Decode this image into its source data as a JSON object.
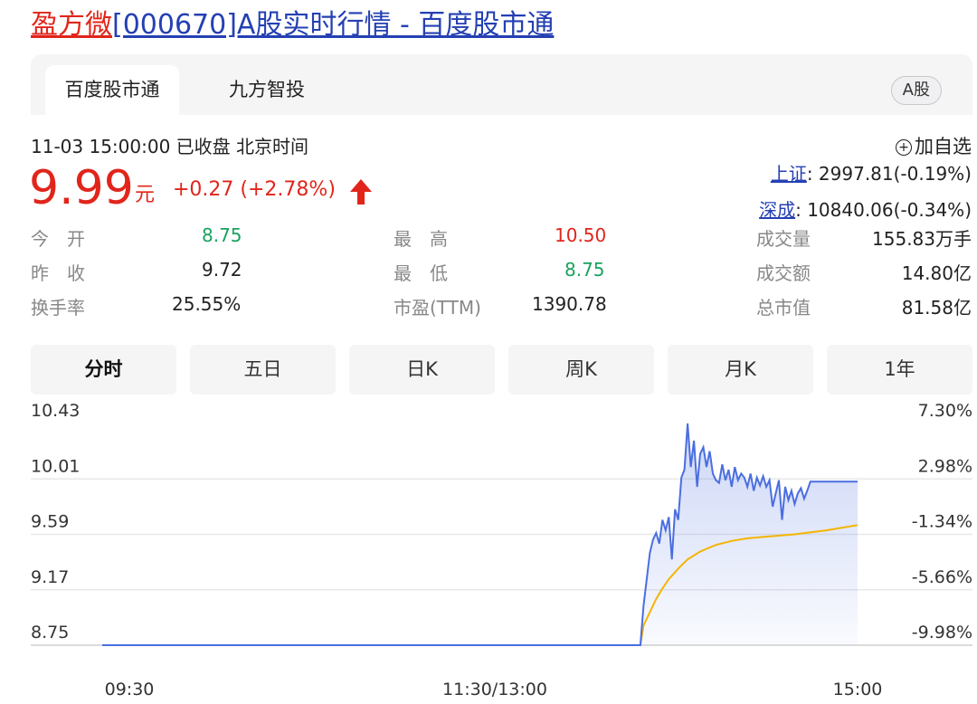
{
  "page_title": {
    "stock_name": "盈方微",
    "rest": "[000670]A股实时行情 - 百度股市通"
  },
  "tabs": {
    "active": "百度股市通",
    "second": "九方智投",
    "badge": "A股"
  },
  "status": {
    "datetime": "11-03 15:00:00",
    "state": "已收盘",
    "timezone": "北京时间",
    "add_favorite": "加自选"
  },
  "quote": {
    "price": "9.99",
    "unit": "元",
    "change": "+0.27 (+2.78%)"
  },
  "indices": [
    {
      "name": "上证",
      "value": ": 2997.81(-0.19%)"
    },
    {
      "name": "深成",
      "value": ": 10840.06(-0.34%)"
    }
  ],
  "stats": {
    "open_label": "今　开",
    "open_value": "8.75",
    "prev_close_label": "昨　收",
    "prev_close_value": "9.72",
    "turnover_label": "换手率",
    "turnover_value": "25.55%",
    "high_label": "最　高",
    "high_value": "10.50",
    "low_label": "最　低",
    "low_value": "8.75",
    "pe_label": "市盈(TTM)",
    "pe_value": "1390.78",
    "volume_label": "成交量",
    "volume_value": "155.83万手",
    "amount_label": "成交额",
    "amount_value": "14.80亿",
    "mktcap_label": "总市值",
    "mktcap_value": "81.58亿"
  },
  "periods": [
    "分时",
    "五日",
    "日K",
    "周K",
    "月K",
    "1年"
  ],
  "active_period": "分时",
  "colors": {
    "up": "#e1251b",
    "down": "#1aa260",
    "link": "#2440b3",
    "price_line": "#4a6ee0",
    "avg_line": "#f5b400"
  },
  "chart_data": {
    "type": "line",
    "x_labels": [
      "09:30",
      "11:30/13:00",
      "15:00"
    ],
    "y_left_ticks": [
      "10.43",
      "10.01",
      "9.59",
      "9.17",
      "8.75"
    ],
    "y_right_ticks": [
      "7.30%",
      "2.98%",
      "-1.34%",
      "-5.66%",
      "-9.98%"
    ],
    "ylim": [
      8.75,
      10.43
    ],
    "x_range_minutes": [
      0,
      240
    ],
    "series": [
      {
        "key": "price",
        "x": [
          0,
          171,
          172,
          173,
          174,
          175,
          176,
          177,
          178,
          179,
          180,
          181,
          182,
          183,
          184,
          185,
          186,
          187,
          188,
          189,
          190,
          191,
          192,
          193,
          194,
          195,
          196,
          197,
          198,
          199,
          200,
          201,
          202,
          203,
          204,
          205,
          206,
          207,
          208,
          209,
          210,
          211,
          212,
          213,
          214,
          215,
          216,
          217,
          218,
          219,
          220,
          221,
          222,
          223,
          224,
          225,
          226,
          227,
          228,
          229,
          230,
          231,
          232,
          233,
          234,
          235,
          236,
          237,
          238,
          239,
          240
        ],
        "values": [
          8.75,
          8.75,
          9.05,
          9.25,
          9.45,
          9.55,
          9.6,
          9.52,
          9.7,
          9.62,
          9.72,
          9.4,
          9.78,
          9.7,
          10.02,
          10.08,
          10.43,
          10.1,
          10.3,
          9.95,
          10.2,
          10.25,
          10.1,
          10.22,
          10.05,
          10.0,
          9.98,
          10.12,
          10.0,
          10.08,
          9.95,
          10.1,
          10.0,
          10.05,
          10.02,
          9.95,
          10.05,
          9.92,
          10.02,
          9.96,
          10.03,
          9.95,
          10.0,
          9.8,
          9.9,
          10.0,
          9.7,
          9.95,
          9.85,
          9.92,
          9.82,
          9.9,
          9.94,
          9.86,
          9.92,
          9.99,
          9.99,
          9.99,
          9.99,
          9.99,
          9.99,
          9.99,
          9.99,
          9.99,
          9.99,
          9.99,
          9.99,
          9.99,
          9.99,
          9.99,
          9.99
        ]
      },
      {
        "key": "average",
        "x": [
          0,
          171,
          172,
          174,
          176,
          178,
          180,
          183,
          186,
          190,
          195,
          200,
          205,
          210,
          220,
          230,
          240
        ],
        "values": [
          8.75,
          8.75,
          8.9,
          9.0,
          9.1,
          9.18,
          9.25,
          9.33,
          9.4,
          9.46,
          9.51,
          9.54,
          9.56,
          9.57,
          9.59,
          9.62,
          9.66
        ]
      }
    ],
    "grid": true
  }
}
